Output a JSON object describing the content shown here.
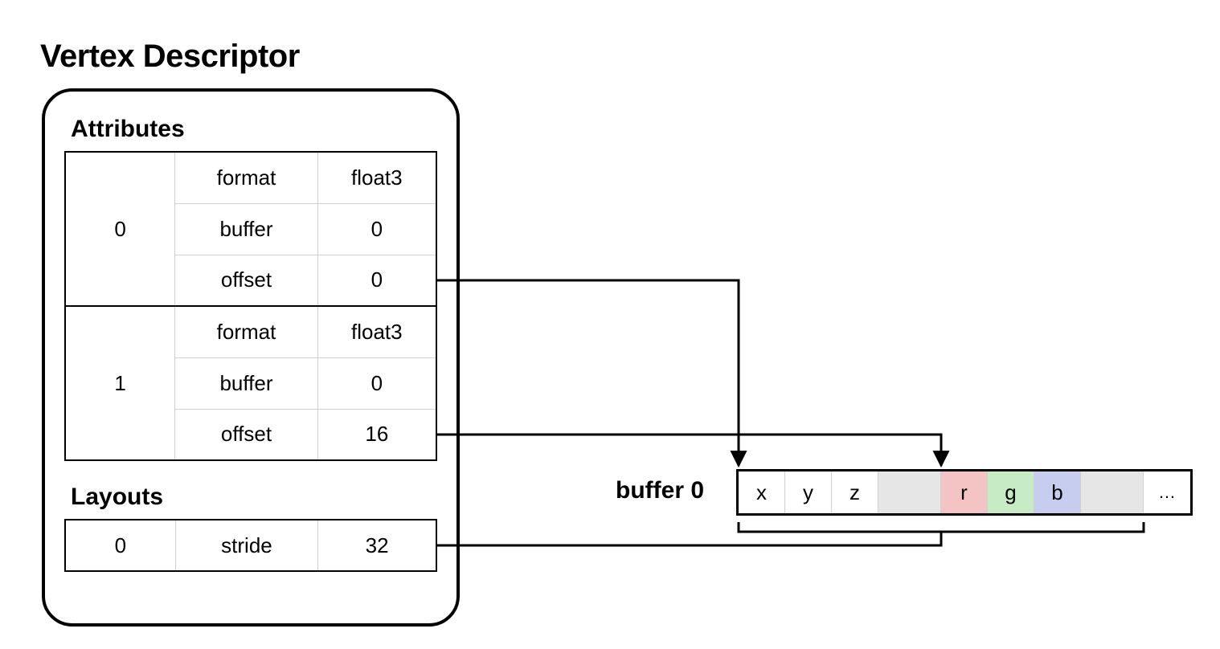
{
  "title": "Vertex Descriptor",
  "attributes_label": "Attributes",
  "layouts_label": "Layouts",
  "attributes": [
    {
      "index": "0",
      "rows": [
        {
          "key": "format",
          "value": "float3"
        },
        {
          "key": "buffer",
          "value": "0"
        },
        {
          "key": "offset",
          "value": "0"
        }
      ]
    },
    {
      "index": "1",
      "rows": [
        {
          "key": "format",
          "value": "float3"
        },
        {
          "key": "buffer",
          "value": "0"
        },
        {
          "key": "offset",
          "value": "16"
        }
      ]
    }
  ],
  "layouts": [
    {
      "index": "0",
      "rows": [
        {
          "key": "stride",
          "value": "32"
        }
      ]
    }
  ],
  "buffer": {
    "label": "buffer 0",
    "cells": [
      "x",
      "y",
      "z",
      "",
      "r",
      "g",
      "b",
      "",
      "…"
    ]
  }
}
